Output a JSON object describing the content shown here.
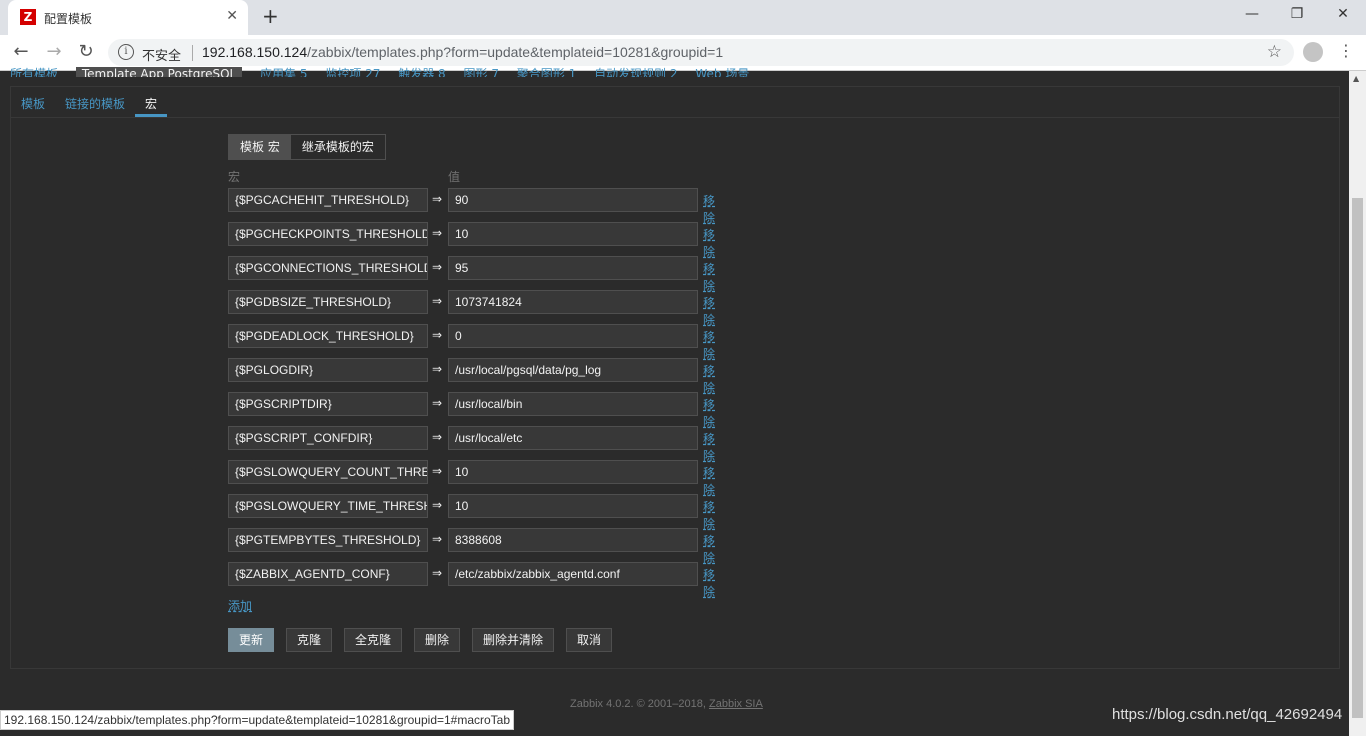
{
  "browser": {
    "tab_title": "配置模板",
    "favicon_letter": "Z",
    "insecure_label": "不安全",
    "url_host": "192.168.150.124",
    "url_path": "/zabbix/templates.php?form=update&templateid=10281&groupid=1",
    "status_url": "192.168.150.124/zabbix/templates.php?form=update&templateid=10281&groupid=1#macroTab"
  },
  "breadcrumb": {
    "items": [
      "所有模板",
      "Template App PostgreSQL",
      "应用集 5",
      "监控项 27",
      "触发器 8",
      "图形 7",
      "聚合图形 1",
      "自动发现规则 2",
      "Web 场景"
    ]
  },
  "panel_tabs": [
    "模板",
    "链接的模板",
    "宏"
  ],
  "subtabs": [
    "模板 宏",
    "继承模板的宏"
  ],
  "columns": {
    "macro": "宏",
    "value": "值"
  },
  "arrow_symbol": "⇒",
  "remove_label": "移除",
  "macros": [
    {
      "name": "{$PGCACHEHIT_THRESHOLD}",
      "value": "90"
    },
    {
      "name": "{$PGCHECKPOINTS_THRESHOLD}",
      "value": "10"
    },
    {
      "name": "{$PGCONNECTIONS_THRESHOLD}",
      "value": "95"
    },
    {
      "name": "{$PGDBSIZE_THRESHOLD}",
      "value": "1073741824"
    },
    {
      "name": "{$PGDEADLOCK_THRESHOLD}",
      "value": "0"
    },
    {
      "name": "{$PGLOGDIR}",
      "value": "/usr/local/pgsql/data/pg_log"
    },
    {
      "name": "{$PGSCRIPTDIR}",
      "value": "/usr/local/bin"
    },
    {
      "name": "{$PGSCRIPT_CONFDIR}",
      "value": "/usr/local/etc"
    },
    {
      "name": "{$PGSLOWQUERY_COUNT_THRESHOLD}",
      "value": "10"
    },
    {
      "name": "{$PGSLOWQUERY_TIME_THRESHOLD}",
      "value": "10"
    },
    {
      "name": "{$PGTEMPBYTES_THRESHOLD}",
      "value": "8388608"
    },
    {
      "name": "{$ZABBIX_AGENTD_CONF}",
      "value": "/etc/zabbix/zabbix_agentd.conf"
    }
  ],
  "add_label": "添加",
  "buttons": {
    "update": "更新",
    "clone": "克隆",
    "full_clone": "全克隆",
    "delete": "删除",
    "delete_clear": "删除并清除",
    "cancel": "取消"
  },
  "footer": {
    "text": "Zabbix 4.0.2. © 2001–2018,",
    "link": "Zabbix SIA"
  },
  "watermark": "https://blog.csdn.net/qq_42692494",
  "colors": {
    "background": "#2b2b2b",
    "link": "#4796c4",
    "field": "#383838",
    "primary_button": "#768d99"
  }
}
